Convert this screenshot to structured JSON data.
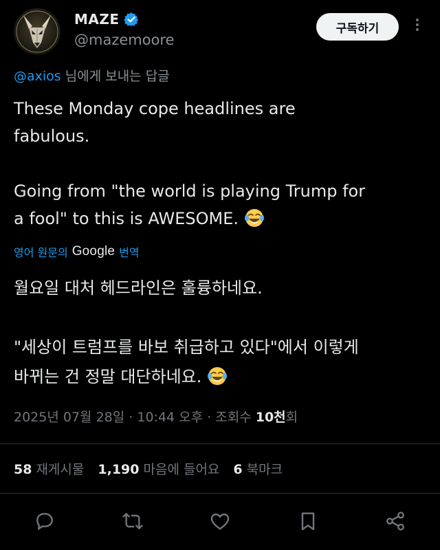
{
  "user": {
    "display_name": "MAZE",
    "handle": "@mazemoore",
    "verified_color": "#1d9bf0"
  },
  "header": {
    "subscribe_label": "구독하기",
    "more_icon": "more-vertical-icon"
  },
  "reply": {
    "mention": "@axios",
    "suffix": " 님에게 보내는 답글"
  },
  "tweet": {
    "text_part1": "These Monday cope headlines are\nfabulous.\n\nGoing from \"the world is playing Trump for\na fool\" to this is AWESOME. ",
    "emoji": "face-with-tears-of-joy"
  },
  "translation": {
    "prefix": "영어 원문의",
    "brand": "Google",
    "suffix": "번역",
    "text_part1": "월요일 대처 헤드라인은 훌륭하네요.\n\n\"세상이 트럼프를 바보 취급하고 있다\"에서 이렇게\n바뀌는 건 정말 대단하네요. "
  },
  "meta": {
    "date": "2025년 07월 28일",
    "sep1": " · ",
    "time": "10:44 오후",
    "sep2": " · ",
    "views_label": "조회수 ",
    "views_count": "10천",
    "views_suffix": "회"
  },
  "stats": {
    "reposts_count": "58",
    "reposts_label": "재게시물",
    "likes_count": "1,190",
    "likes_label": "마음에 들어요",
    "bookmarks_count": "6",
    "bookmarks_label": "북마크"
  },
  "actions": [
    "reply-icon",
    "repost-icon",
    "like-icon",
    "bookmark-icon",
    "share-icon"
  ],
  "colors": {
    "background": "#000000",
    "text": "#e7e9ea",
    "muted": "#71767b",
    "link": "#1d9bf0"
  }
}
